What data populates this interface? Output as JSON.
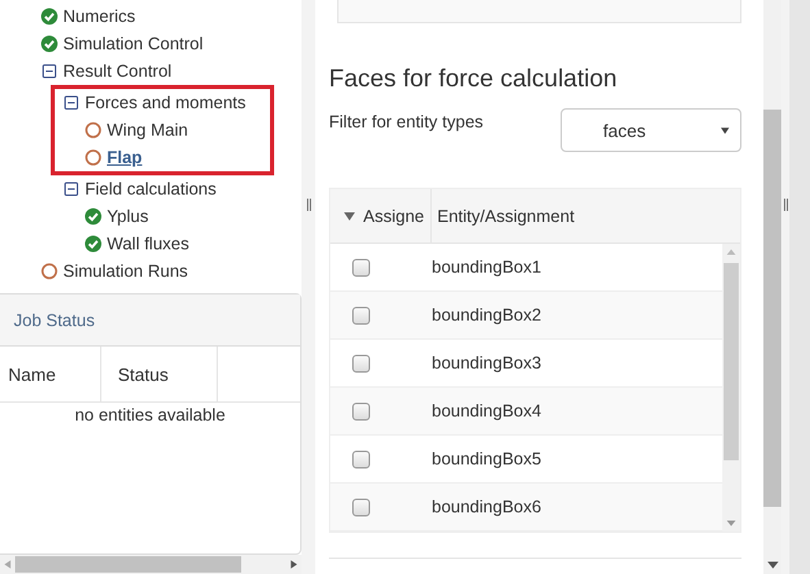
{
  "tree": [
    {
      "label": "Numerics",
      "kind": "done",
      "selected": false
    },
    {
      "label": "Simulation Control",
      "kind": "done",
      "selected": false
    },
    {
      "label": "Result Control",
      "kind": "group",
      "expanded": true,
      "children": [
        {
          "label": "Forces and moments",
          "kind": "group",
          "expanded": true,
          "highlighted": true,
          "children": [
            {
              "label": "Wing Main",
              "kind": "pending",
              "selected": false
            },
            {
              "label": "Flap",
              "kind": "pending",
              "selected": true
            }
          ]
        },
        {
          "label": "Field calculations",
          "kind": "group",
          "expanded": true,
          "children": [
            {
              "label": "Yplus",
              "kind": "done",
              "selected": false
            },
            {
              "label": "Wall fluxes",
              "kind": "done",
              "selected": false
            }
          ]
        }
      ]
    },
    {
      "label": "Simulation Runs",
      "kind": "pending",
      "selected": false
    }
  ],
  "job_status": {
    "title": "Job Status",
    "columns": [
      "Name",
      "Status"
    ],
    "empty_text": "no entities available"
  },
  "faces_section": {
    "heading": "Faces for force calculation",
    "filter_label": "Filter for entity types",
    "filter_value": "faces",
    "columns": [
      {
        "label": "Assigne",
        "sort_icon": true
      },
      {
        "label": "Entity/Assignment",
        "sort_icon": false
      }
    ],
    "rows": [
      {
        "checked": false,
        "entity": "boundingBox1"
      },
      {
        "checked": false,
        "entity": "boundingBox2"
      },
      {
        "checked": false,
        "entity": "boundingBox3"
      },
      {
        "checked": false,
        "entity": "boundingBox4"
      },
      {
        "checked": false,
        "entity": "boundingBox5"
      },
      {
        "checked": false,
        "entity": "boundingBox6"
      }
    ]
  }
}
